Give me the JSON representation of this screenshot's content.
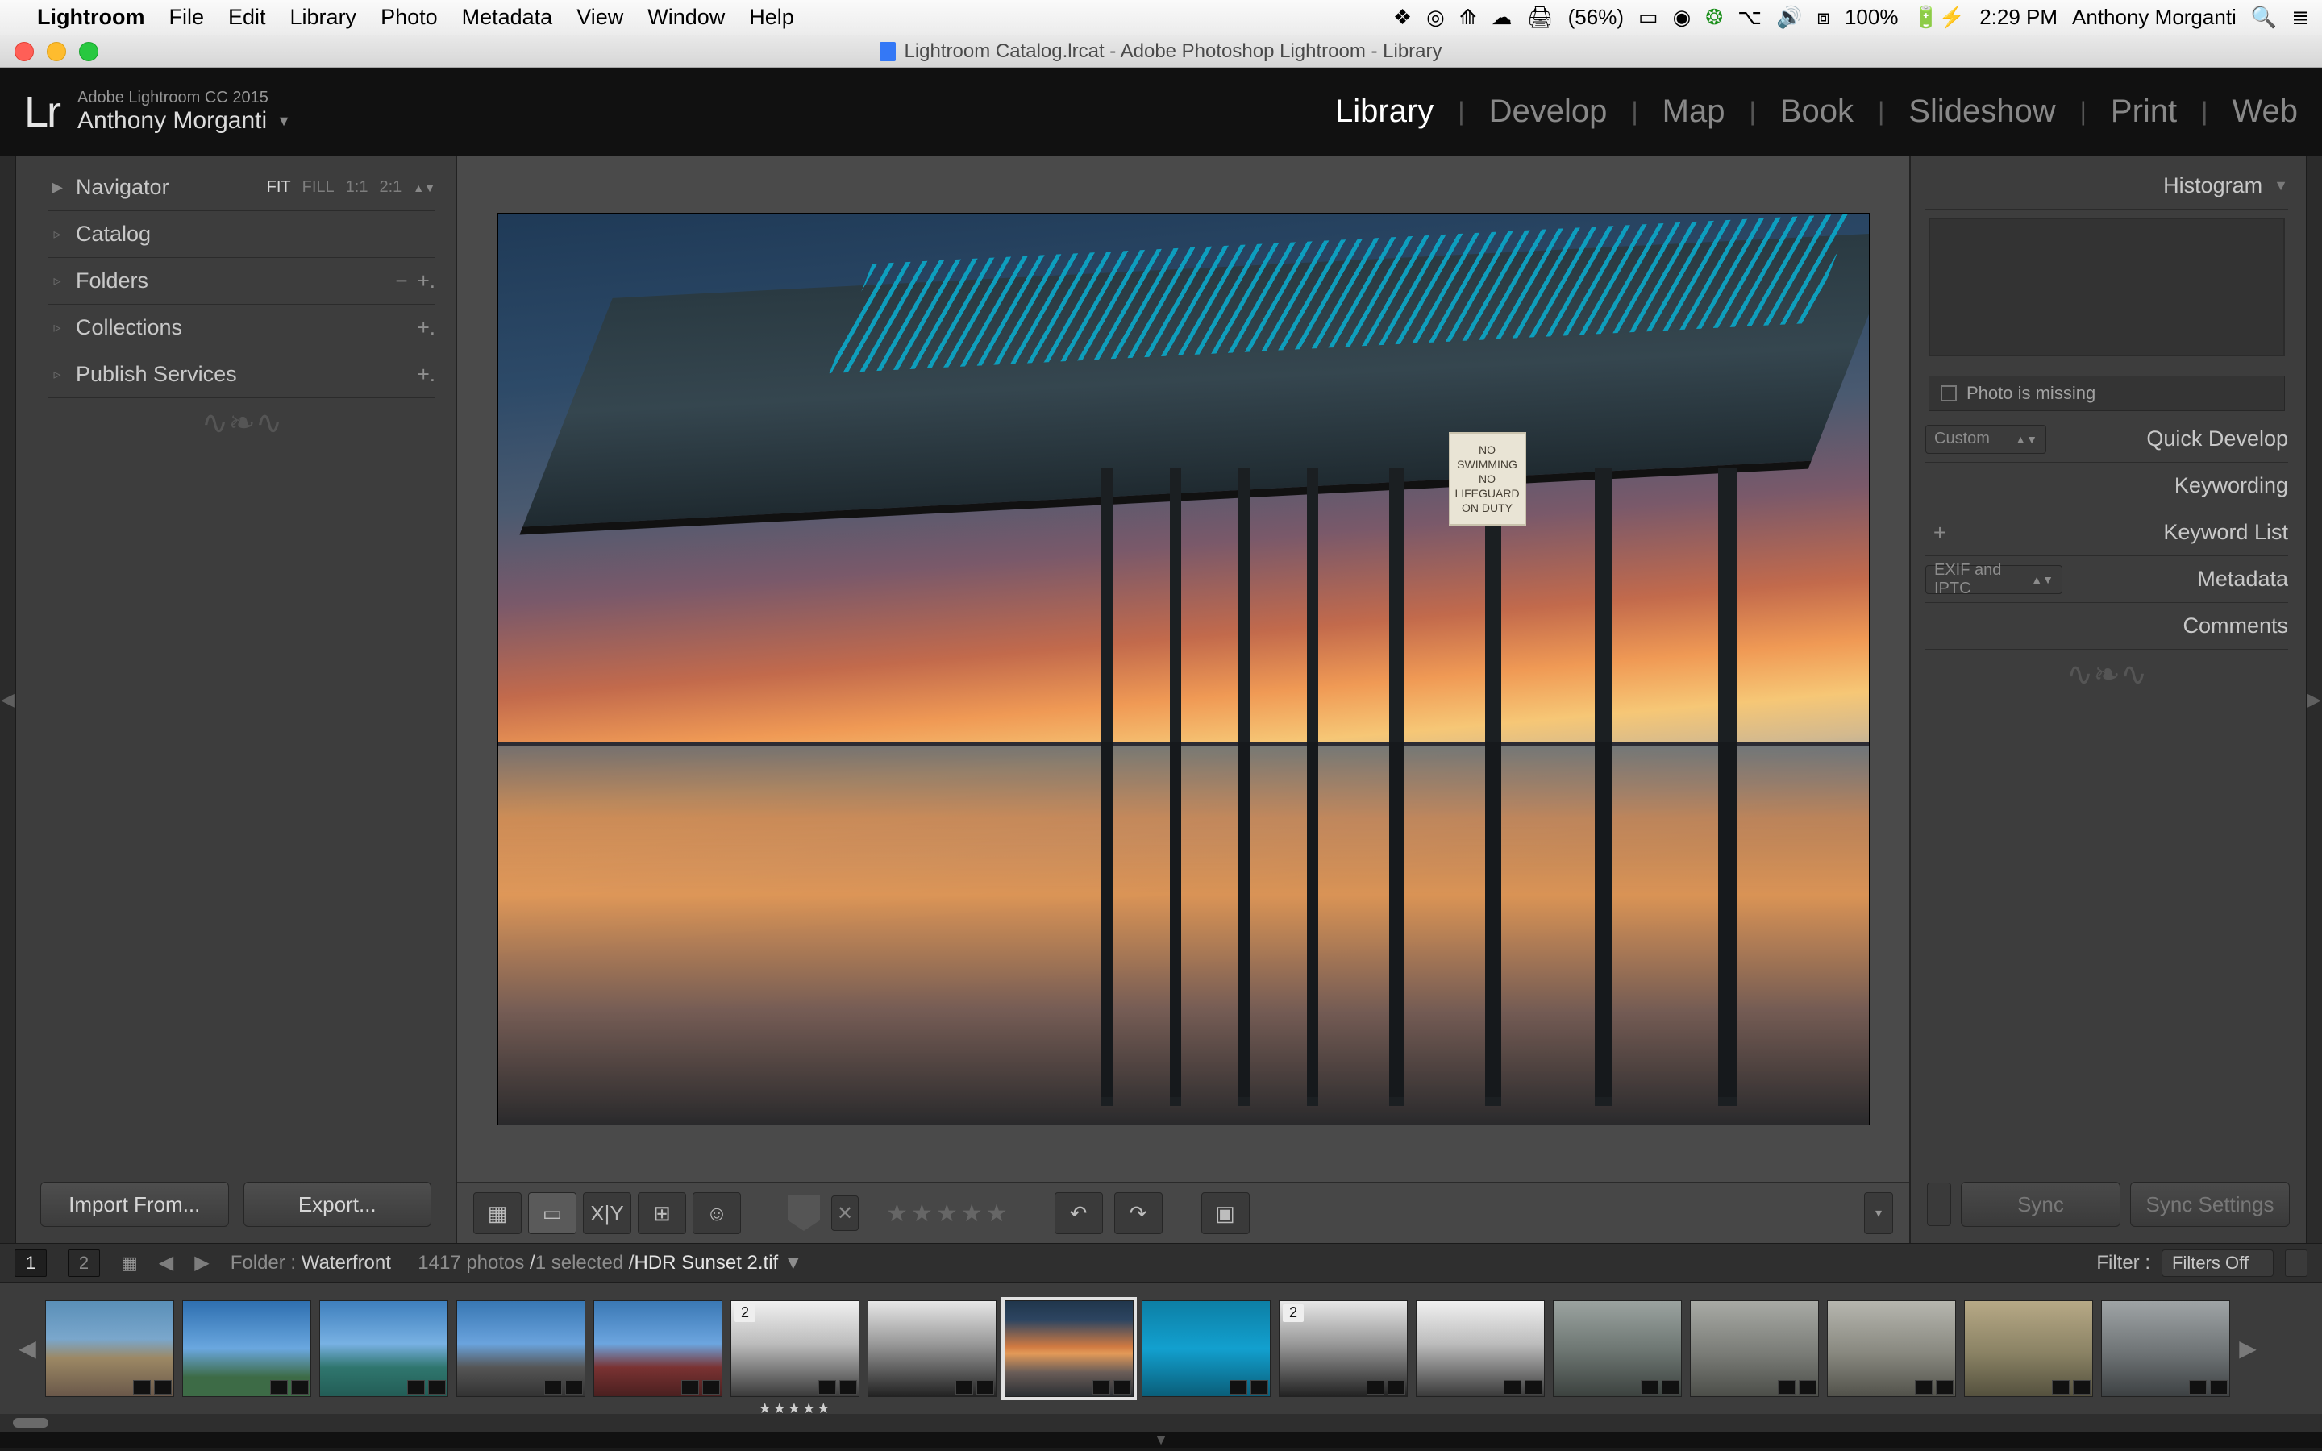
{
  "mac_menu": {
    "apple": "",
    "app": "Lightroom",
    "items": [
      "File",
      "Edit",
      "Library",
      "Photo",
      "Metadata",
      "View",
      "Window",
      "Help"
    ],
    "status": {
      "battery_menu": "(56%)",
      "wifi_pct": "100%",
      "clock": "2:29 PM",
      "user": "Anthony Morganti"
    }
  },
  "titlebar": "Lightroom Catalog.lrcat - Adobe Photoshop Lightroom - Library",
  "identity": {
    "logo": "Lr",
    "line1": "Adobe Lightroom CC 2015",
    "line2": "Anthony Morganti"
  },
  "modules": [
    "Library",
    "Develop",
    "Map",
    "Book",
    "Slideshow",
    "Print",
    "Web"
  ],
  "active_module": "Library",
  "left": {
    "navigator": "Navigator",
    "zoom": {
      "fit": "FIT",
      "fill": "FILL",
      "one": "1:1",
      "two": "2:1"
    },
    "panels": [
      "Catalog",
      "Folders",
      "Collections",
      "Publish Services"
    ],
    "import_btn": "Import From...",
    "export_btn": "Export..."
  },
  "right": {
    "histogram": "Histogram",
    "missing": "Photo is missing",
    "qd_preset": "Custom",
    "quick_develop": "Quick Develop",
    "keywording": "Keywording",
    "keyword_list": "Keyword List",
    "metadata": "Metadata",
    "metadata_preset": "EXIF and IPTC",
    "comments": "Comments",
    "sync": "Sync",
    "sync_settings": "Sync Settings"
  },
  "sign": {
    "l1": "NO SWIMMING",
    "l2": "NO LIFEGUARD",
    "l3": "ON DUTY"
  },
  "secbar": {
    "src1": "1",
    "src2": "2",
    "folder_label": "Folder :",
    "folder_name": "Waterfront",
    "count": "1417 photos",
    "selected": "1 selected",
    "filename": "HDR Sunset 2.tif",
    "filter_label": "Filter :",
    "filter_value": "Filters Off"
  },
  "film_badges": {
    "b5": "2",
    "b10": "2"
  },
  "stars5": "★★★★★"
}
